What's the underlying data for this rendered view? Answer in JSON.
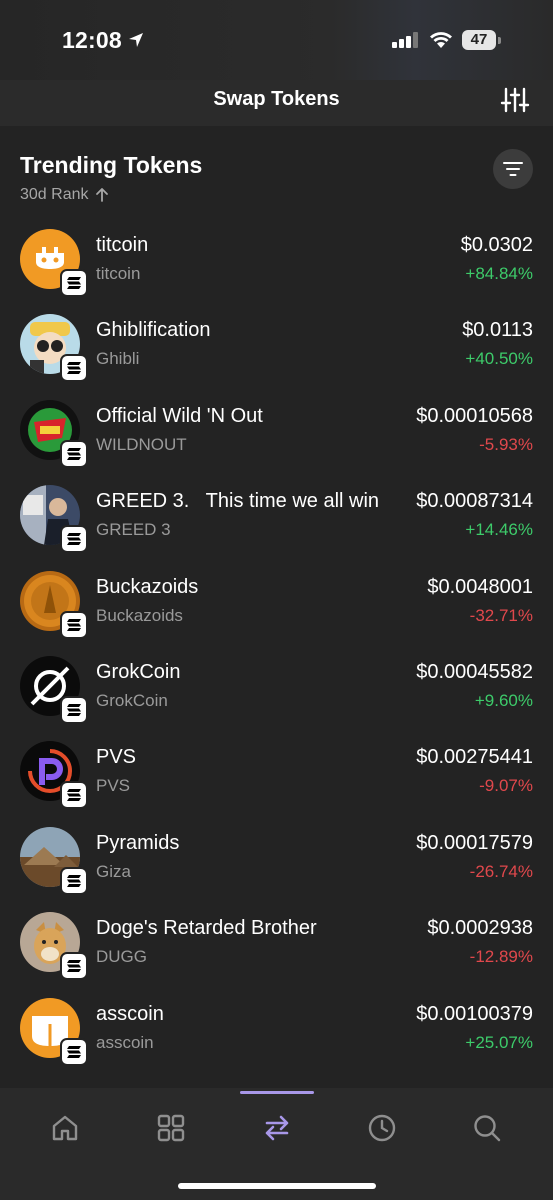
{
  "status_bar": {
    "time": "12:08",
    "battery": "47"
  },
  "header": {
    "title": "Swap Tokens"
  },
  "section": {
    "title": "Trending Tokens",
    "sort_label": "30d Rank"
  },
  "colors": {
    "up": "#3dcb6a",
    "down": "#e0484c",
    "accent": "#a897e8"
  },
  "tokens": [
    {
      "name": "titcoin",
      "symbol": "titcoin",
      "price": "$0.0302",
      "change": "+84.84%",
      "direction": "up",
      "icon": "titcoin-logo"
    },
    {
      "name": "Ghiblification",
      "symbol": "Ghibli",
      "price": "$0.0113",
      "change": "+40.50%",
      "direction": "up",
      "icon": "ghibli-logo"
    },
    {
      "name": "Official Wild 'N Out",
      "symbol": "WILDNOUT",
      "price": "$0.00010568",
      "change": "-5.93%",
      "direction": "down",
      "icon": "wildnout-logo"
    },
    {
      "name": "GREED 3.   This time we all win",
      "symbol": "GREED 3",
      "price": "$0.00087314",
      "change": "+14.46%",
      "direction": "up",
      "icon": "greed-logo"
    },
    {
      "name": "Buckazoids",
      "symbol": "Buckazoids",
      "price": "$0.0048001",
      "change": "-32.71%",
      "direction": "down",
      "icon": "buckazoids-logo"
    },
    {
      "name": "GrokCoin",
      "symbol": "GrokCoin",
      "price": "$0.00045582",
      "change": "+9.60%",
      "direction": "up",
      "icon": "grokcoin-logo"
    },
    {
      "name": "PVS",
      "symbol": "PVS",
      "price": "$0.00275441",
      "change": "-9.07%",
      "direction": "down",
      "icon": "pvs-logo"
    },
    {
      "name": "Pyramids",
      "symbol": "Giza",
      "price": "$0.00017579",
      "change": "-26.74%",
      "direction": "down",
      "icon": "pyramids-logo"
    },
    {
      "name": "Doge's Retarded Brother",
      "symbol": "DUGG",
      "price": "$0.0002938",
      "change": "-12.89%",
      "direction": "down",
      "icon": "dugg-logo"
    },
    {
      "name": "asscoin",
      "symbol": "asscoin",
      "price": "$0.00100379",
      "change": "+25.07%",
      "direction": "up",
      "icon": "asscoin-logo"
    }
  ],
  "tab_bar": {
    "tabs": [
      {
        "icon": "home-icon",
        "active": false
      },
      {
        "icon": "grid-icon",
        "active": false
      },
      {
        "icon": "swap-icon",
        "active": true
      },
      {
        "icon": "clock-icon",
        "active": false
      },
      {
        "icon": "search-icon",
        "active": false
      }
    ]
  }
}
